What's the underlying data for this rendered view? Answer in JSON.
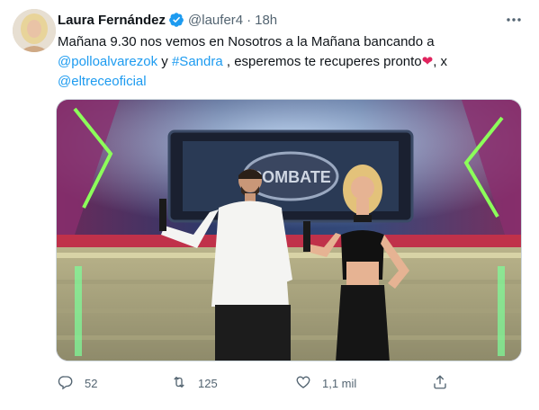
{
  "tweet": {
    "author_name": "Laura Fernández",
    "handle": "@laufer4",
    "separator": "·",
    "time": "18h",
    "text_line1": "Mañana 9.30 nos vemos en Nosotros a la Mañana bancando a",
    "mention1": "@polloalvarezok",
    "connector": " y ",
    "hashtag": "#Sandra",
    "text_part2": " , esperemos te recuperes pronto",
    "heart_emoji": "❤",
    "text_part3": ", x",
    "mention2": "@eltreceoficial",
    "image_sign_text": "COMBATE"
  },
  "actions": {
    "reply_count": "52",
    "retweet_count": "125",
    "like_count": "1,1 mil"
  },
  "icons": [
    "verified-badge-icon",
    "more-options-icon",
    "reply-icon",
    "retweet-icon",
    "like-icon",
    "share-icon"
  ],
  "colors": {
    "link": "#1d9bf0",
    "secondary": "#536471",
    "verified": "#1d9bf0",
    "heart": "#e0245e"
  }
}
